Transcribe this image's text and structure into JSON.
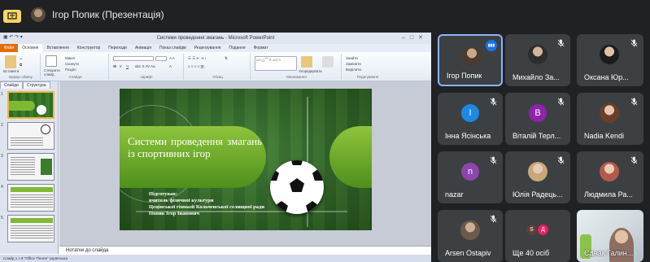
{
  "meeting": {
    "presenter_title": "Ігор Попик (Презентація)"
  },
  "powerpoint": {
    "window_title": "Системи проведення змагань - Microsoft PowerPoint",
    "tabs": [
      "Файл",
      "Основне",
      "Вставлення",
      "Конструктор",
      "Переходи",
      "Анімація",
      "Показ слайдів",
      "Рецензування",
      "Подання",
      "Формат"
    ],
    "ribbon_groups": [
      "Буфер обміну",
      "Слайди",
      "Шрифт",
      "Абзац",
      "Малювання",
      "Редагування"
    ],
    "ribbon_buttons": {
      "paste": "Вставити",
      "new_slide": "Створити слайд",
      "layout": "Макет",
      "reset": "Скинути",
      "section": "Розділ",
      "find": "Знайти",
      "replace": "Замінити",
      "select": "Виділити",
      "arrange": "Упорядкувати",
      "quick_styles": "Експрес-стилі"
    },
    "pane_tabs": [
      "Слайди",
      "Структура"
    ],
    "slide": {
      "title": "Системи проведення змагань із спортивних ігор",
      "author_lines": [
        "Підготував:",
        "вчитель фізичної культури",
        "Цецінської гімназії Кольченської селищної ради",
        "Попик Ігор Іванович"
      ]
    },
    "notes_placeholder": "Нотатки до слайда",
    "status": "Слайд 1 з 9   \"Office Theme\"   українська"
  },
  "participants": [
    {
      "name": "Ігор Попик",
      "type": "photo",
      "speaking": true
    },
    {
      "name": "Михайло За...",
      "type": "photo",
      "muted": true
    },
    {
      "name": "Оксана Юр...",
      "type": "photo",
      "muted": true
    },
    {
      "name": "Інна Ясінська",
      "type": "letter",
      "letter": "І",
      "color": "#1e88e5",
      "muted": true
    },
    {
      "name": "Віталій Терл...",
      "type": "letter",
      "letter": "В",
      "color": "#8e24aa",
      "muted": true
    },
    {
      "name": "Nadia Kendi",
      "type": "photo",
      "muted": true
    },
    {
      "name": "nazar",
      "type": "letter",
      "letter": "n",
      "color": "#8e44ad",
      "muted": true
    },
    {
      "name": "Юлія Радець...",
      "type": "photo",
      "muted": true
    },
    {
      "name": "Людмила Ра...",
      "type": "photo",
      "muted": true
    },
    {
      "name": "Arsen Ostapiv",
      "type": "photo",
      "muted": true
    },
    {
      "name": "Ще 40 осіб",
      "type": "more",
      "letters": [
        "S",
        "Д"
      ]
    },
    {
      "name": "Єднак Галин...",
      "type": "video"
    }
  ],
  "colors": {
    "accent": "#8ab4f8",
    "speaking": "#1a73e8",
    "tile": "#3c4043",
    "bg": "#202124"
  }
}
